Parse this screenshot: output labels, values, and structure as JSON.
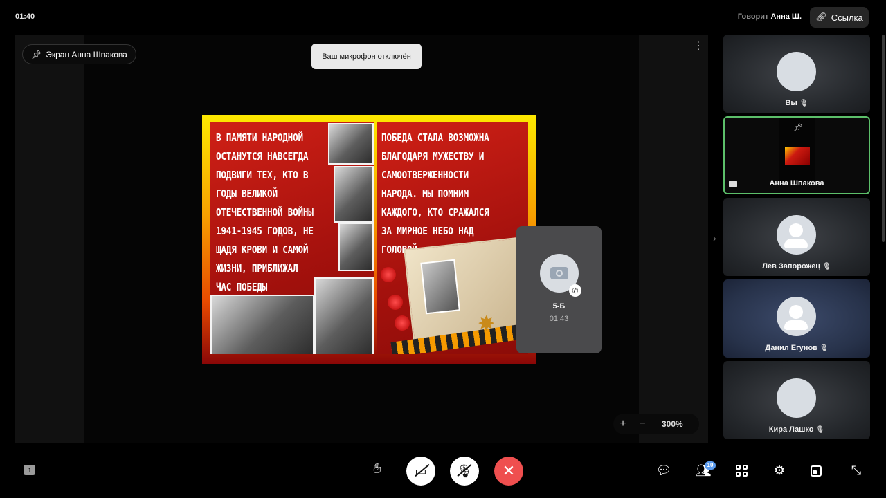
{
  "header": {
    "time": "01:40",
    "speaking_label": "Говорит",
    "speaking_name": "Анна Ш.",
    "link_label": "Ссылка"
  },
  "stage": {
    "screen_badge": "Экран Анна Шпакова",
    "toast": "Ваш микрофон отключён",
    "poster_left_text": "В ПАМЯТИ НАРОДНОЙ\nОСТАНУТСЯ НАВСЕГДА\nПОДВИГИ ТЕХ, КТО В\nГОДЫ ВЕЛИКОЙ\nОТЕЧЕСТВЕННОЙ ВОЙНЫ\n1941-1945 ГОДОВ, НЕ\nЩАДЯ КРОВИ И САМОЙ\nЖИЗНИ, ПРИБЛИЖАЛ\nЧАС ПОБЕДЫ",
    "poster_right_text": "ПОБЕДА СТАЛА ВОЗМОЖНА\nБЛАГОДАРЯ МУЖЕСТВУ И\nСАМООТВЕРЖЕННОСТИ\nНАРОДА. МЫ ПОМНИМ\nКАЖДОГО, КТО СРАЖАЛСЯ\nЗА МИРНОЕ НЕБО НАД\nГОЛОВОЙ.",
    "zoom_plus": "+",
    "zoom_minus": "−",
    "zoom_value": "300%"
  },
  "call": {
    "name": "5-Б",
    "duration": "01:43"
  },
  "participants": [
    {
      "name": "Вы",
      "muted": true
    },
    {
      "name": "Анна Шпакова",
      "muted": false,
      "active": true
    },
    {
      "name": "Лев Запорожец",
      "muted": true
    },
    {
      "name": "Данил Егунов",
      "muted": true
    },
    {
      "name": "Кира Лашко",
      "muted": true
    }
  ],
  "toolbar": {
    "participants_count": "10"
  },
  "colors": {
    "active_border": "#5cbf6a",
    "hangup": "#ef4f4f",
    "badge": "#5b9cf0"
  }
}
